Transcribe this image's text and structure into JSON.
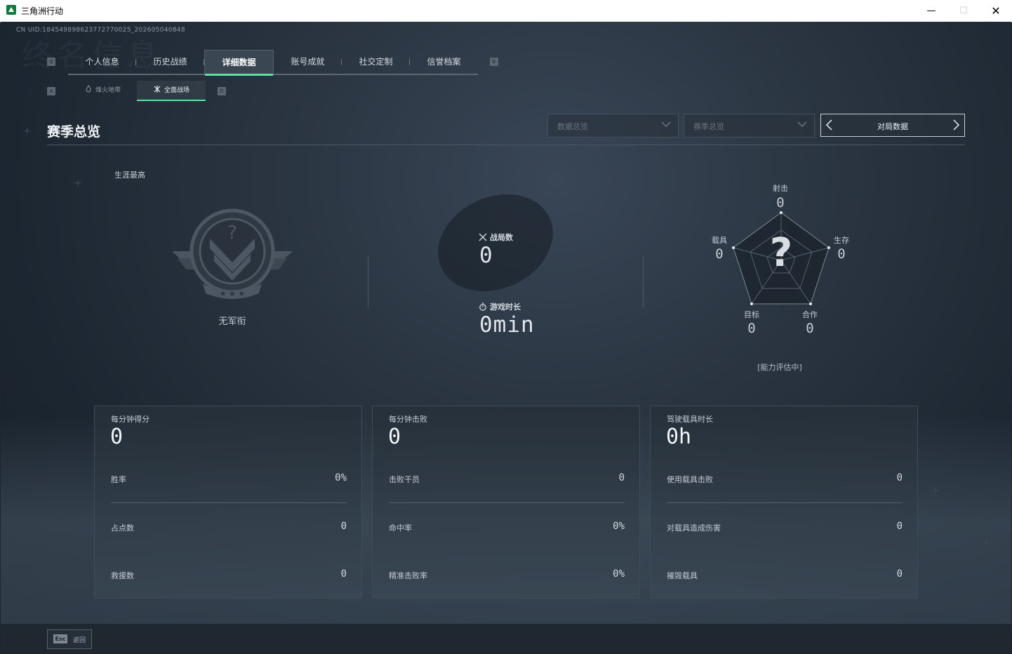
{
  "window": {
    "title": "三角洲行动"
  },
  "uid": "CN UID:184549898623772770025_202605040848",
  "background_text": "终名信息",
  "nav": {
    "left_key": "Q",
    "right_key": "E",
    "tabs": [
      "个人信息",
      "历史战绩",
      "详细数据",
      "账号成就",
      "社交定制",
      "信誉档案"
    ],
    "active_tab": "详细数据"
  },
  "subnav": {
    "left_key": "A",
    "right_key": "D",
    "tabs": [
      "烽火地带",
      "全面战场"
    ],
    "active_tab": "全面战场"
  },
  "header": {
    "title": "赛季总览",
    "dropdown1": "数据总览",
    "dropdown2": "赛季总览",
    "pager_label": "对局数据"
  },
  "rank": {
    "label": "生涯最高",
    "name": "无军衔"
  },
  "center": {
    "matches_label": "战局数",
    "matches_value": "0",
    "time_label": "游戏时长",
    "time_value": "0min"
  },
  "radar": {
    "axes": [
      {
        "label": "射击",
        "value": "0"
      },
      {
        "label": "生存",
        "value": "0"
      },
      {
        "label": "合作",
        "value": "0"
      },
      {
        "label": "目标",
        "value": "0"
      },
      {
        "label": "载具",
        "value": "0"
      }
    ],
    "center_glyph": "?",
    "status": "[能力评估中]"
  },
  "cards": [
    {
      "title": "每分钟得分",
      "big": "0",
      "rows": [
        {
          "label": "胜率",
          "value": "0%"
        },
        {
          "label": "占点数",
          "value": "0"
        },
        {
          "label": "救援数",
          "value": "0"
        }
      ]
    },
    {
      "title": "每分钟击败",
      "big": "0",
      "rows": [
        {
          "label": "击败干员",
          "value": "0"
        },
        {
          "label": "命中率",
          "value": "0%"
        },
        {
          "label": "精准击败率",
          "value": "0%"
        }
      ]
    },
    {
      "title": "驾驶载具时长",
      "big": "0h",
      "rows": [
        {
          "label": "使用载具击败",
          "value": "0"
        },
        {
          "label": "对载具造成伤害",
          "value": "0"
        },
        {
          "label": "摧毁载具",
          "value": "0"
        }
      ]
    }
  ],
  "footer": {
    "esc_key": "Esc",
    "back_label": "返回"
  },
  "colors": {
    "accent": "#5fe0a0",
    "background": "#1c2530"
  }
}
